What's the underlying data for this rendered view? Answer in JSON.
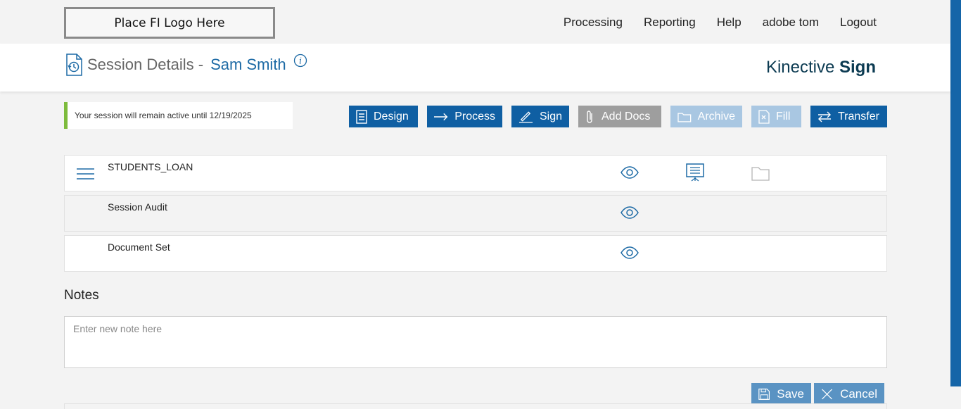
{
  "header": {
    "logo_text": "Place FI Logo Here",
    "nav": [
      "Processing",
      "Reporting",
      "Help",
      "adobe tom",
      "Logout"
    ]
  },
  "session": {
    "label": "Session Details -",
    "customer_name": "Sam Smith",
    "brand_prefix": "Kinective",
    "brand_suffix": "Sign",
    "notice": "Your session will remain active until 12/19/2025"
  },
  "actions": {
    "design": "Design",
    "process": "Process",
    "sign": "Sign",
    "add_docs": "Add Docs",
    "archive": "Archive",
    "fill": "Fill",
    "transfer": "Transfer"
  },
  "documents": [
    {
      "title": "STUDENTS_LOAN"
    },
    {
      "title": "Session Audit"
    },
    {
      "title": "Document Set"
    }
  ],
  "notes": {
    "title": "Notes",
    "placeholder": "Enter new note here",
    "save": "Save",
    "cancel": "Cancel"
  },
  "colors": {
    "primary": "#0f5fa3",
    "accent_green": "#7dbb3c",
    "disabled_gray": "#9e9e9e",
    "disabled_light": "#a9c7e2",
    "brand_dark": "#0c3b52"
  },
  "icons": {
    "menu": "hamburger-icon",
    "view": "eye-icon",
    "present": "presentation-icon",
    "folder": "folder-icon",
    "info": "info-icon"
  }
}
